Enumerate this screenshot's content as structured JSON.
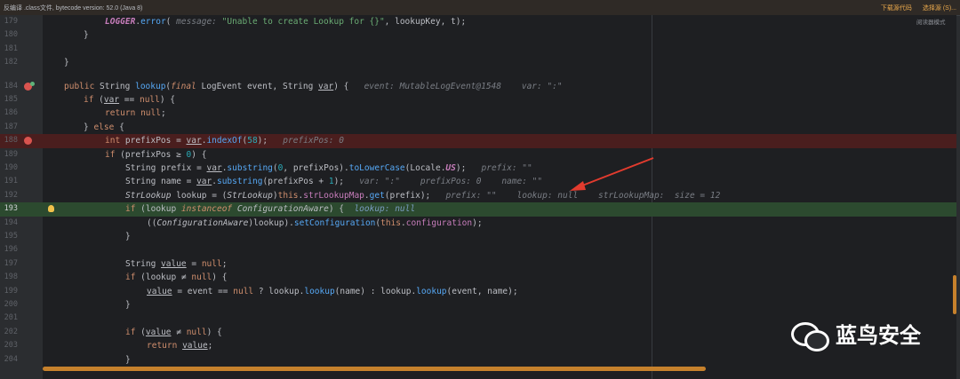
{
  "topbar": {
    "message": "反编译 .class文件, bytecode version: 52.0 (Java 8)",
    "download_label": "下载源代码",
    "choose_label": "选择源 (S)..."
  },
  "reader_mode": "阅读器模式",
  "watermark": {
    "text": "蓝鸟安全",
    "icon": "wechat-icon"
  },
  "colors": {
    "breakpoint_line": "#4a1e1e",
    "current_line": "#2c4a2f",
    "scrollbar": "#c6812c"
  },
  "lines": [
    {
      "n": "179"
    },
    {
      "n": "180"
    },
    {
      "n": "181"
    },
    {
      "n": "182"
    },
    {
      "n": "184"
    },
    {
      "n": "185"
    },
    {
      "n": "186"
    },
    {
      "n": "187"
    },
    {
      "n": "188"
    },
    {
      "n": "189"
    },
    {
      "n": "190"
    },
    {
      "n": "191"
    },
    {
      "n": "192"
    },
    {
      "n": "193"
    },
    {
      "n": "194"
    },
    {
      "n": "195"
    },
    {
      "n": "196"
    },
    {
      "n": "197"
    },
    {
      "n": "198"
    },
    {
      "n": "199"
    },
    {
      "n": "200"
    },
    {
      "n": "201"
    },
    {
      "n": "202"
    },
    {
      "n": "203"
    },
    {
      "n": "204"
    }
  ],
  "code": {
    "l179_logger": "LOGGER",
    "l179_error": "error",
    "l179_msg_hint": "message:",
    "l179_str": "\"Unable to create Lookup for {}\"",
    "l179_rest": ", lookupKey, t);",
    "l184_public": "public",
    "l184_sig1": " String ",
    "l184_fn": "lookup",
    "l184_final": "final",
    "l184_sig2": " LogEvent event, String ",
    "l184_var": "var",
    "l184_sig3": ") {",
    "l184_hint": "event: MutableLogEvent@1548    var: \":\"",
    "l185_if": "if",
    "l185_a": " (",
    "l185_var": "var",
    "l185_b": " == ",
    "l185_null": "null",
    "l185_c": ") {",
    "l186_return": "return",
    "l186_null": "null",
    "l187_else": "else",
    "l188_int": "int",
    "l188_a": " prefixPos = ",
    "l188_var": "var",
    "l188_b": ".",
    "l188_fn": "indexOf",
    "l188_num": "58",
    "l188_hint": "prefixPos: 0",
    "l189_if": "if",
    "l189_a": " (prefixPos ≥ ",
    "l189_num": "0",
    "l189_b": ") {",
    "l190_a": "String prefix = ",
    "l190_var": "var",
    "l190_fn1": "substring",
    "l190_num": "0",
    "l190_b": ", prefixPos).",
    "l190_fn2": "toLowerCase",
    "l190_c": "(Locale.",
    "l190_us": "US",
    "l190_d": ");",
    "l190_hint": "prefix: \"\"",
    "l191_a": "String name = ",
    "l191_var": "var",
    "l191_fn": "substring",
    "l191_b": "(prefixPos + ",
    "l191_num": "1",
    "l191_c": ");",
    "l191_hint": "var: \":\"    prefixPos: 0    name: \"\"",
    "l192_a": "StrLookup",
    "l192_b": " lookup = (",
    "l192_c": "StrLookup",
    "l192_d": ")",
    "l192_this": "this",
    "l192_fld": "strLookupMap",
    "l192_fn": "get",
    "l192_e": "(prefix);",
    "l192_hint": "prefix: \"\"    lookup: null    strLookupMap:  size = 12",
    "l193_if": "if",
    "l193_a": " (lookup ",
    "l193_inst": "instanceof",
    "l193_b": " ",
    "l193_type": "ConfigurationAware",
    "l193_c": ") {",
    "l193_hint": "lookup: null",
    "l194_a": "((",
    "l194_type": "ConfigurationAware",
    "l194_b": ")lookup).",
    "l194_fn": "setConfiguration",
    "l194_c": "(",
    "l194_this": "this",
    "l194_d": ".",
    "l194_fld": "configuration",
    "l194_e": ");",
    "l197_a": "String ",
    "l197_val": "value",
    "l197_b": " = ",
    "l197_null": "null",
    "l198_if": "if",
    "l198_a": " (lookup ≠ ",
    "l198_null": "null",
    "l198_b": ") {",
    "l199_val": "value",
    "l199_a": " = event == ",
    "l199_null": "null",
    "l199_b": " ? lookup.",
    "l199_fn1": "lookup",
    "l199_c": "(name) : lookup.",
    "l199_fn2": "lookup",
    "l199_d": "(event, name);",
    "l202_if": "if",
    "l202_a": " (",
    "l202_val": "value",
    "l202_b": " ≠ ",
    "l202_null": "null",
    "l202_c": ") {",
    "l203_return": "return",
    "l203_val": "value",
    "l203_end": ";",
    "close": "}",
    "close_else": "} ",
    "open_brace": " {",
    "paren_open": "(",
    "paren_close": ")",
    "paren_semi": ");",
    "semi": ";",
    "dot": ".",
    "lparen": "(",
    "space": " "
  }
}
